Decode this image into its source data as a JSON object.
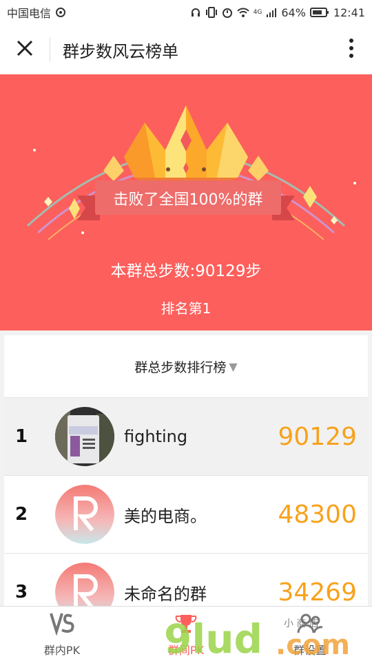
{
  "status": {
    "carrier": "中国电信",
    "battery": "64%",
    "time": "12:41",
    "network": "4G"
  },
  "header": {
    "title": "群步数风云榜单"
  },
  "hero": {
    "ribbon": "击败了全国100%的群",
    "total": "本群总步数:90129步",
    "rank": "排名第1",
    "bg_color": "#fc5f5c"
  },
  "board": {
    "title": "群总步数排行榜",
    "arrow": "▼",
    "rows": [
      {
        "rank": "1",
        "name": "fighting",
        "steps": "90129",
        "avatar": "photo"
      },
      {
        "rank": "2",
        "name": "美的电商。",
        "steps": "48300",
        "avatar": "R-logo"
      },
      {
        "rank": "3",
        "name": "未命名的群",
        "steps": "34269",
        "avatar": "R-logo"
      }
    ],
    "steps_color": "#f7a21b"
  },
  "tabs": [
    {
      "label": "群内PK",
      "icon": "vs-icon"
    },
    {
      "label": "群间PK",
      "icon": "trophy-icon"
    },
    {
      "label": "群设置",
      "icon": "group-settings-icon"
    }
  ],
  "watermark": {
    "text": "9lud.com",
    "sub": "小 商 店"
  }
}
